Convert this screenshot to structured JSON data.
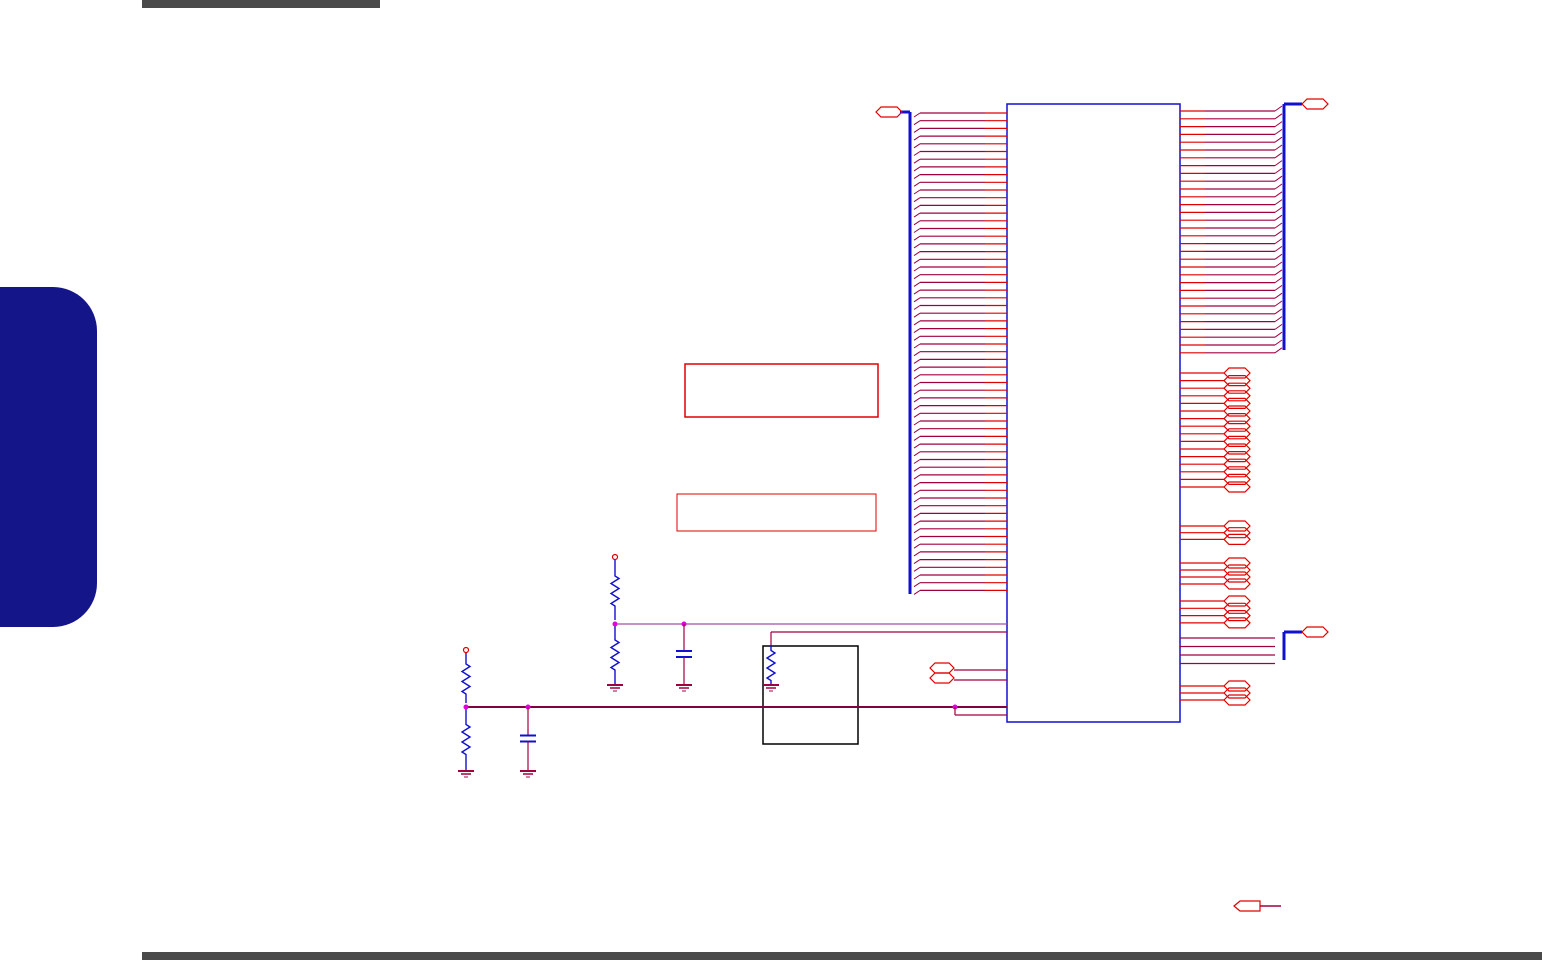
{
  "page": {
    "header_bar_color": "#4a4a4a",
    "footer_bar_color": "#4a4a4a",
    "side_tab_color": "#15158a",
    "side_tab_label": ""
  },
  "schematic": {
    "wire_color": "#a00040",
    "pin_color": "#e00000",
    "bus_color": "#1010d0",
    "box_color": "#e00000",
    "junction_color": "#e000e0",
    "cap_color": "#1010d0",
    "chip_label": "",
    "note_box_1_text": "",
    "note_box_2_text": "",
    "sub_block_label": ""
  }
}
